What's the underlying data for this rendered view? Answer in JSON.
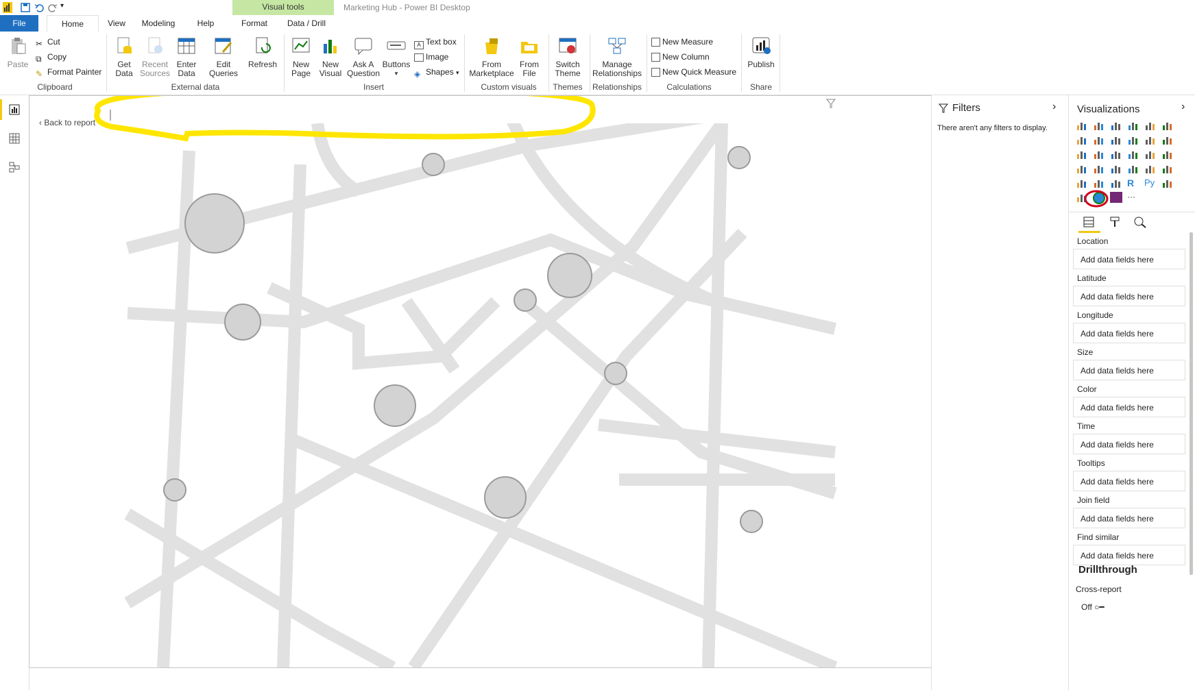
{
  "window": {
    "title": "Marketing Hub - Power BI Desktop",
    "context_tab": "Visual tools"
  },
  "tabs": [
    "File",
    "Home",
    "View",
    "Modeling",
    "Help",
    "Format",
    "Data / Drill"
  ],
  "ribbon": {
    "clipboard": {
      "paste": "Paste",
      "cut": "Cut",
      "copy": "Copy",
      "format_painter": "Format Painter",
      "group": "Clipboard"
    },
    "external": {
      "get_data": [
        "Get",
        "Data"
      ],
      "recent": [
        "Recent",
        "Sources"
      ],
      "enter": [
        "Enter",
        "Data"
      ],
      "edit": [
        "Edit",
        "Queries"
      ],
      "refresh": "Refresh",
      "group": "External data"
    },
    "insert": {
      "new_page": [
        "New",
        "Page"
      ],
      "new_visual": [
        "New",
        "Visual"
      ],
      "ask": [
        "Ask A",
        "Question"
      ],
      "buttons": "Buttons",
      "text_box": "Text box",
      "image": "Image",
      "shapes": "Shapes",
      "group": "Insert"
    },
    "custom": {
      "marketplace": [
        "From",
        "Marketplace"
      ],
      "file": [
        "From",
        "File"
      ],
      "group": "Custom visuals"
    },
    "themes": {
      "switch": [
        "Switch",
        "Theme"
      ],
      "group": "Themes"
    },
    "relationships": {
      "manage": [
        "Manage",
        "Relationships"
      ],
      "group": "Relationships"
    },
    "calculations": {
      "new_measure": "New Measure",
      "new_column": "New Column",
      "new_quick_measure": "New Quick Measure",
      "group": "Calculations"
    },
    "share": {
      "publish": "Publish",
      "group": "Share"
    }
  },
  "canvas": {
    "back_label": "Back to report"
  },
  "filters": {
    "title": "Filters",
    "empty": "There aren't any filters to display."
  },
  "visualizations": {
    "title": "Visualizations",
    "fields": [
      {
        "label": "Location",
        "placeholder": "Add data fields here"
      },
      {
        "label": "Latitude",
        "placeholder": "Add data fields here"
      },
      {
        "label": "Longitude",
        "placeholder": "Add data fields here"
      },
      {
        "label": "Size",
        "placeholder": "Add data fields here"
      },
      {
        "label": "Color",
        "placeholder": "Add data fields here"
      },
      {
        "label": "Time",
        "placeholder": "Add data fields here"
      },
      {
        "label": "Tooltips",
        "placeholder": "Add data fields here"
      },
      {
        "label": "Join field",
        "placeholder": "Add data fields here"
      },
      {
        "label": "Find similar",
        "placeholder": "Add data fields here"
      }
    ],
    "drillthrough": {
      "title": "Drillthrough",
      "cross_report": "Cross-report",
      "toggle": "Off"
    }
  },
  "colors": {
    "file_tab": "#1f6fc0",
    "visual_tools": "#c5e7a3",
    "highlight": "#ffe600",
    "circle_annotation": "#d0021b",
    "road": "#e1e1e1",
    "bubble": "#d3d3d3"
  }
}
